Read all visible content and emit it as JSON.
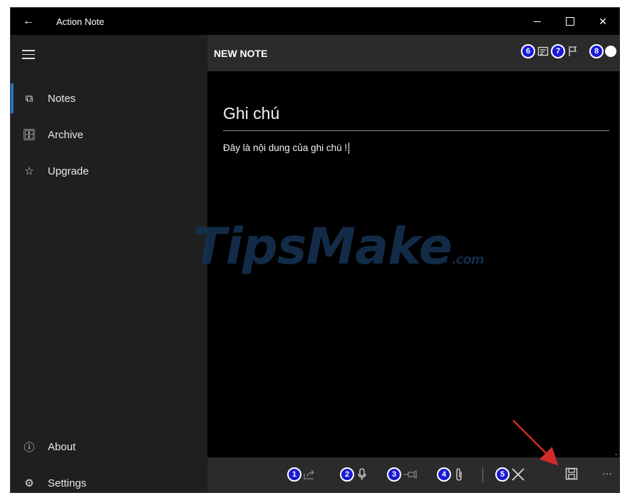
{
  "window": {
    "title": "Action Note",
    "back_icon": "←",
    "close_icon": "✕"
  },
  "sidebar": {
    "items": [
      {
        "label": "Notes",
        "icon": "copy-icon",
        "glyph": "⧉"
      },
      {
        "label": "Archive",
        "icon": "archive-icon",
        "glyph": "🗄"
      },
      {
        "label": "Upgrade",
        "icon": "star-icon",
        "glyph": "☆"
      }
    ],
    "bottom": [
      {
        "label": "About",
        "icon": "info-icon",
        "glyph": "ⓘ"
      },
      {
        "label": "Settings",
        "icon": "gear-icon",
        "glyph": "⚙"
      }
    ]
  },
  "header": {
    "title": "NEW NOTE",
    "badges": [
      "6",
      "7",
      "8"
    ]
  },
  "note": {
    "title": "Ghi chú",
    "body": "Đây là nội dung của ghi chú !"
  },
  "watermark": {
    "main": "TipsMake",
    "suffix": ".com"
  },
  "appbar": {
    "badges": [
      "1",
      "2",
      "3",
      "4",
      "5"
    ],
    "more": "···"
  },
  "colors": {
    "accent": "#2b6fbf",
    "badge": "#1a1ad6",
    "annotation_arrow": "#d42a2a"
  }
}
